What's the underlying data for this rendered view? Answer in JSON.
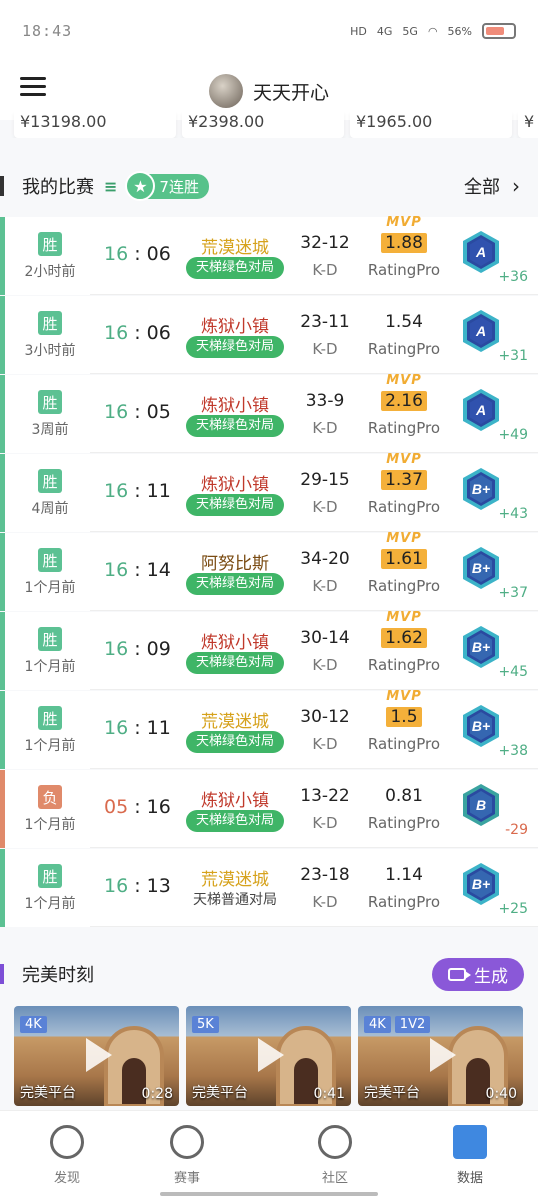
{
  "status": {
    "time": "18:43",
    "net1": "HD",
    "net2": "4G",
    "net3": "5G",
    "battery": "56%"
  },
  "header": {
    "username": "天天开心"
  },
  "amounts": [
    "¥13198.00",
    "¥2398.00",
    "¥1965.00",
    "¥"
  ],
  "my_matches": {
    "title": "我的比赛",
    "streak": "7连胜",
    "all_label": "全部",
    "items": [
      {
        "result": "胜",
        "when": "2小时前",
        "score_a": "16",
        "score_b": "06",
        "map": "荒漠迷城",
        "map_color": "#d6a21c",
        "mode": "天梯绿色对局",
        "kd": "32-12",
        "kd_label": "K-D",
        "mvp": "MVP",
        "rating": "1.88",
        "rating_label": "RatingPro",
        "rank": "A",
        "points": "+36"
      },
      {
        "result": "胜",
        "when": "3小时前",
        "score_a": "16",
        "score_b": "06",
        "map": "炼狱小镇",
        "map_color": "#c0392b",
        "mode": "天梯绿色对局",
        "kd": "23-11",
        "kd_label": "K-D",
        "mvp": "",
        "rating": "1.54",
        "rating_label": "RatingPro",
        "rank": "A",
        "points": "+31"
      },
      {
        "result": "胜",
        "when": "3周前",
        "score_a": "16",
        "score_b": "05",
        "map": "炼狱小镇",
        "map_color": "#c0392b",
        "mode": "天梯绿色对局",
        "kd": "33-9",
        "kd_label": "K-D",
        "mvp": "MVP",
        "rating": "2.16",
        "rating_label": "RatingPro",
        "rank": "A",
        "points": "+49"
      },
      {
        "result": "胜",
        "when": "4周前",
        "score_a": "16",
        "score_b": "11",
        "map": "炼狱小镇",
        "map_color": "#c0392b",
        "mode": "天梯绿色对局",
        "kd": "29-15",
        "kd_label": "K-D",
        "mvp": "MVP",
        "rating": "1.37",
        "rating_label": "RatingPro",
        "rank": "B+",
        "points": "+43"
      },
      {
        "result": "胜",
        "when": "1个月前",
        "score_a": "16",
        "score_b": "14",
        "map": "阿努比斯",
        "map_color": "#7a4b12",
        "mode": "天梯绿色对局",
        "kd": "34-20",
        "kd_label": "K-D",
        "mvp": "MVP",
        "rating": "1.61",
        "rating_label": "RatingPro",
        "rank": "B+",
        "points": "+37"
      },
      {
        "result": "胜",
        "when": "1个月前",
        "score_a": "16",
        "score_b": "09",
        "map": "炼狱小镇",
        "map_color": "#c0392b",
        "mode": "天梯绿色对局",
        "kd": "30-14",
        "kd_label": "K-D",
        "mvp": "MVP",
        "rating": "1.62",
        "rating_label": "RatingPro",
        "rank": "B+",
        "points": "+45"
      },
      {
        "result": "胜",
        "when": "1个月前",
        "score_a": "16",
        "score_b": "11",
        "map": "荒漠迷城",
        "map_color": "#d6a21c",
        "mode": "天梯绿色对局",
        "kd": "30-12",
        "kd_label": "K-D",
        "mvp": "MVP",
        "rating": "1.5",
        "rating_label": "RatingPro",
        "rank": "B+",
        "points": "+38"
      },
      {
        "result": "负",
        "when": "1个月前",
        "score_a": "05",
        "score_b": "16",
        "map": "炼狱小镇",
        "map_color": "#c0392b",
        "mode": "天梯绿色对局",
        "kd": "13-22",
        "kd_label": "K-D",
        "mvp": "",
        "rating": "0.81",
        "rating_label": "RatingPro",
        "rank": "B",
        "points": "-29"
      },
      {
        "result": "胜",
        "when": "1个月前",
        "score_a": "16",
        "score_b": "13",
        "map": "荒漠迷城",
        "map_color": "#d6a21c",
        "mode": "天梯普通对局",
        "kd": "23-18",
        "kd_label": "K-D",
        "mvp": "",
        "rating": "1.14",
        "rating_label": "RatingPro",
        "rank": "B+",
        "points": "+25"
      }
    ]
  },
  "moments": {
    "title": "完美时刻",
    "generate_label": "生成",
    "clips": [
      {
        "badges": [
          "4K"
        ],
        "source": "完美平台",
        "duration": "0:28"
      },
      {
        "badges": [
          "5K"
        ],
        "source": "完美平台",
        "duration": "0:41"
      },
      {
        "badges": [
          "4K",
          "1V2"
        ],
        "source": "完美平台",
        "duration": "0:40"
      }
    ]
  },
  "tabs": [
    {
      "label": "发现",
      "icon": "planet-icon"
    },
    {
      "label": "赛事",
      "icon": "trophy-icon"
    },
    {
      "label": "社区",
      "icon": "chat-icon"
    },
    {
      "label": "数据",
      "icon": "chart-icon",
      "active": true
    }
  ],
  "colors": {
    "win": "#5cc193",
    "loss": "#e08a6a",
    "win_score": "#4fae85",
    "loss_score": "#d96a4d",
    "mode_green": "#3fb567",
    "mvp": "#f4b03a",
    "moments_accent": "#8a58d8",
    "rank_blue": "#2a4aa0"
  }
}
